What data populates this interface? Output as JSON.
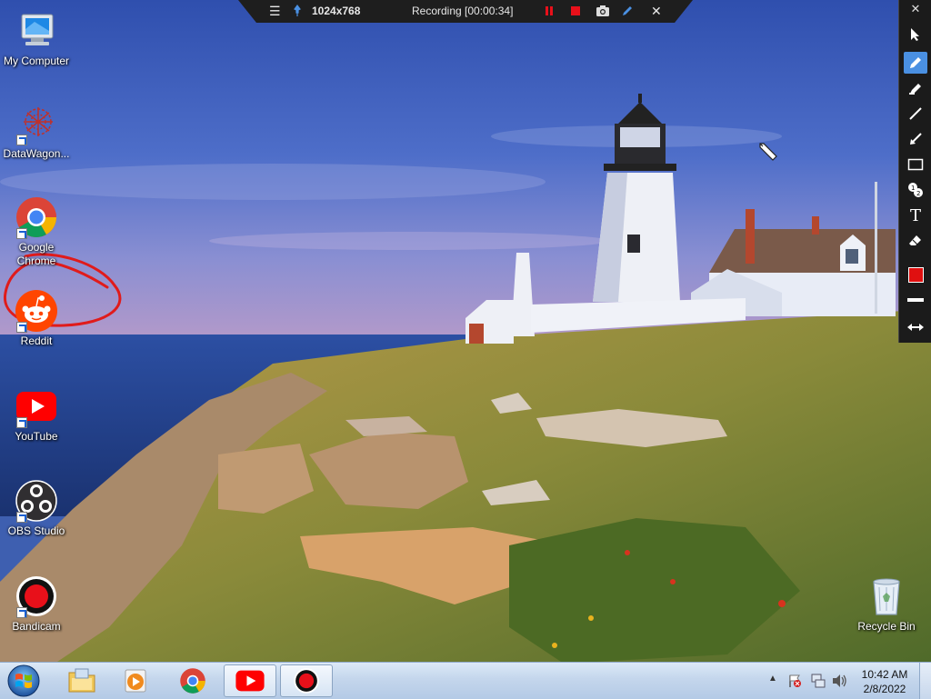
{
  "recording_bar": {
    "resolution": "1024x768",
    "status": "Recording [00:00:34]"
  },
  "desktop_icons": [
    {
      "label": "My Computer",
      "icon": "computer-icon"
    },
    {
      "label": "DataWagon...",
      "icon": "datawagon-icon"
    },
    {
      "label": "Google Chrome",
      "icon": "chrome-icon"
    },
    {
      "label": "Reddit",
      "icon": "reddit-icon"
    },
    {
      "label": "YouTube",
      "icon": "youtube-icon"
    },
    {
      "label": "OBS Studio",
      "icon": "obs-icon"
    },
    {
      "label": "Bandicam",
      "icon": "bandicam-icon"
    },
    {
      "label": "Recycle Bin",
      "icon": "recycle-bin-icon"
    }
  ],
  "draw_toolbar": {
    "tools": [
      "cursor-tool",
      "pen-tool",
      "highlighter-tool",
      "line-tool",
      "arrow-tool",
      "rectangle-tool",
      "numbering-tool",
      "text-tool",
      "eraser-tool"
    ],
    "active_tool": "pen-tool",
    "color": "#e01010"
  },
  "annotation": {
    "color": "#e01b1b",
    "shape": "freehand circle around Reddit icon"
  },
  "taskbar": {
    "pinned": [
      "windows-explorer-icon",
      "media-player-icon",
      "chrome-icon",
      "youtube-icon",
      "bandicam-icon"
    ],
    "clock_time": "10:42 AM",
    "clock_date": "2/8/2022"
  }
}
